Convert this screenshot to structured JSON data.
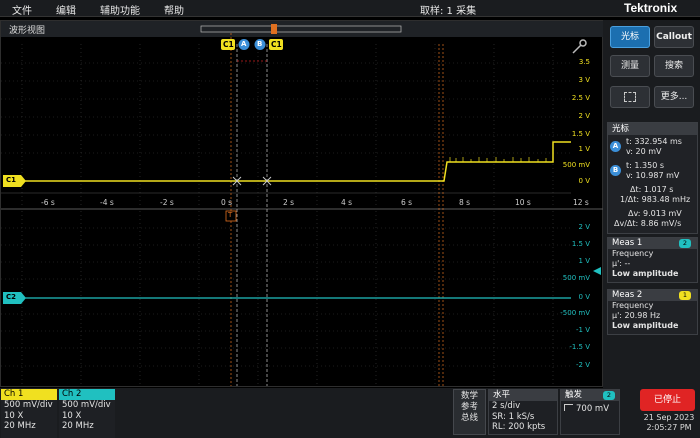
{
  "menu": {
    "items": [
      "文件",
      "编辑",
      "辅助功能",
      "帮助"
    ],
    "acquisition": "取样: 1 采集",
    "logo": "Tektronix"
  },
  "waveform_view": {
    "title": "波形视图",
    "ch1_label": "C1",
    "ch2_label": "C2",
    "trigger_marker": "T",
    "cursor_a": "A",
    "cursor_b": "B",
    "cursor_ch_a": "C1",
    "cursor_ch_b": "C1",
    "time_ticks": [
      "-6 s",
      "-4 s",
      "-2 s",
      "0 s",
      "2 s",
      "4 s",
      "6 s",
      "8 s",
      "10 s",
      "12 s"
    ],
    "ch1_volt_ticks": [
      "3.5",
      "3 V",
      "2.5 V",
      "2 V",
      "1.5 V",
      "1 V",
      "500 mV",
      "0 V"
    ],
    "ch2_volt_ticks": [
      "2 V",
      "1.5 V",
      "1 V",
      "500 mV",
      "0 V",
      "-500 mV",
      "-1 V",
      "-1.5 V",
      "-2 V"
    ],
    "colors": {
      "ch1": "#f0e020",
      "ch2": "#20c0c0",
      "trigger": "#e07020",
      "cursor_a": "#3b8fd8",
      "cursor_b": "#3b8fd8"
    }
  },
  "right_panel": {
    "cursor_button": "光标",
    "callout_button": "Callout",
    "measure_button": "测量",
    "search_button": "搜索",
    "more_button": "更多...",
    "add_icon": "add-cursor-icon"
  },
  "cursor_readout": {
    "title": "光标",
    "a_time": "t: 332.954 ms",
    "a_volt": "v: 20 mV",
    "b_time": "t: 1.350 s",
    "b_volt": "v: 10.987 mV",
    "delta_t": "Δt: 1.017 s",
    "inv_delta_t": "1/Δt: 983.48 mHz",
    "delta_v": "Δv: 9.013 mV",
    "dv_dt": "Δv/Δt: 8.86 mV/s"
  },
  "meas1": {
    "title": "Meas 1",
    "badge": "2",
    "name": "Frequency",
    "value": "μ': --",
    "status": "Low amplitude"
  },
  "meas2": {
    "title": "Meas 2",
    "badge": "1",
    "name": "Frequency",
    "value": "μ': 20.98 Hz",
    "status": "Low amplitude"
  },
  "ch1": {
    "label": "Ch 1",
    "scale": "500 mV/div",
    "probe": "10 X",
    "bw": "20 MHz"
  },
  "ch2": {
    "label": "Ch 2",
    "scale": "500 mV/div",
    "probe": "10 X",
    "bw": "20 MHz"
  },
  "math_ref_bus": {
    "l1": "数学",
    "l2": "参考",
    "l3": "总线"
  },
  "horizontal": {
    "title": "水平",
    "scale": "2 s/div",
    "sr": "SR: 1 kS/s",
    "rl": "RL: 200 kpts"
  },
  "trigger": {
    "title": "触发",
    "badge": "2",
    "level": "700 mV"
  },
  "status": {
    "stop": "已停止",
    "date": "21 Sep 2023",
    "time": "2:05:27 PM"
  }
}
